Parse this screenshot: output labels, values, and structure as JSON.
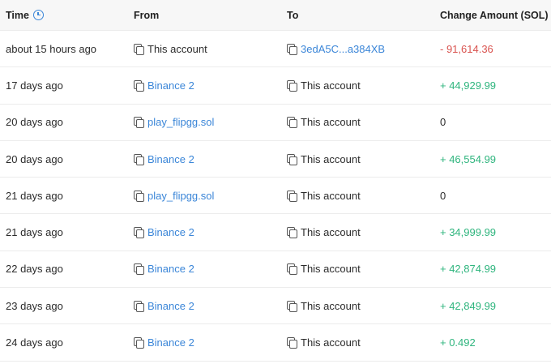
{
  "header": {
    "time": "Time",
    "from": "From",
    "to": "To",
    "amount": "Change Amount (SOL)"
  },
  "rows": [
    {
      "time": "about 15 hours ago",
      "from": "This account",
      "to": "3edA5C...a384XB",
      "amount": "- 91,614.36"
    },
    {
      "time": "17 days ago",
      "from": "Binance 2",
      "to": "This account",
      "amount": "+ 44,929.99"
    },
    {
      "time": "20 days ago",
      "from": "play_flipgg.sol",
      "to": "This account",
      "amount": "0"
    },
    {
      "time": "20 days ago",
      "from": "Binance 2",
      "to": "This account",
      "amount": "+ 46,554.99"
    },
    {
      "time": "21 days ago",
      "from": "play_flipgg.sol",
      "to": "This account",
      "amount": "0"
    },
    {
      "time": "21 days ago",
      "from": "Binance 2",
      "to": "This account",
      "amount": "+ 34,999.99"
    },
    {
      "time": "22 days ago",
      "from": "Binance 2",
      "to": "This account",
      "amount": "+ 42,874.99"
    },
    {
      "time": "23 days ago",
      "from": "Binance 2",
      "to": "This account",
      "amount": "+ 42,849.99"
    },
    {
      "time": "24 days ago",
      "from": "Binance 2",
      "to": "This account",
      "amount": "+ 0.492"
    }
  ],
  "colors": {
    "link": "#3b86d8",
    "negative": "#d9534f",
    "positive": "#2fb57e"
  }
}
